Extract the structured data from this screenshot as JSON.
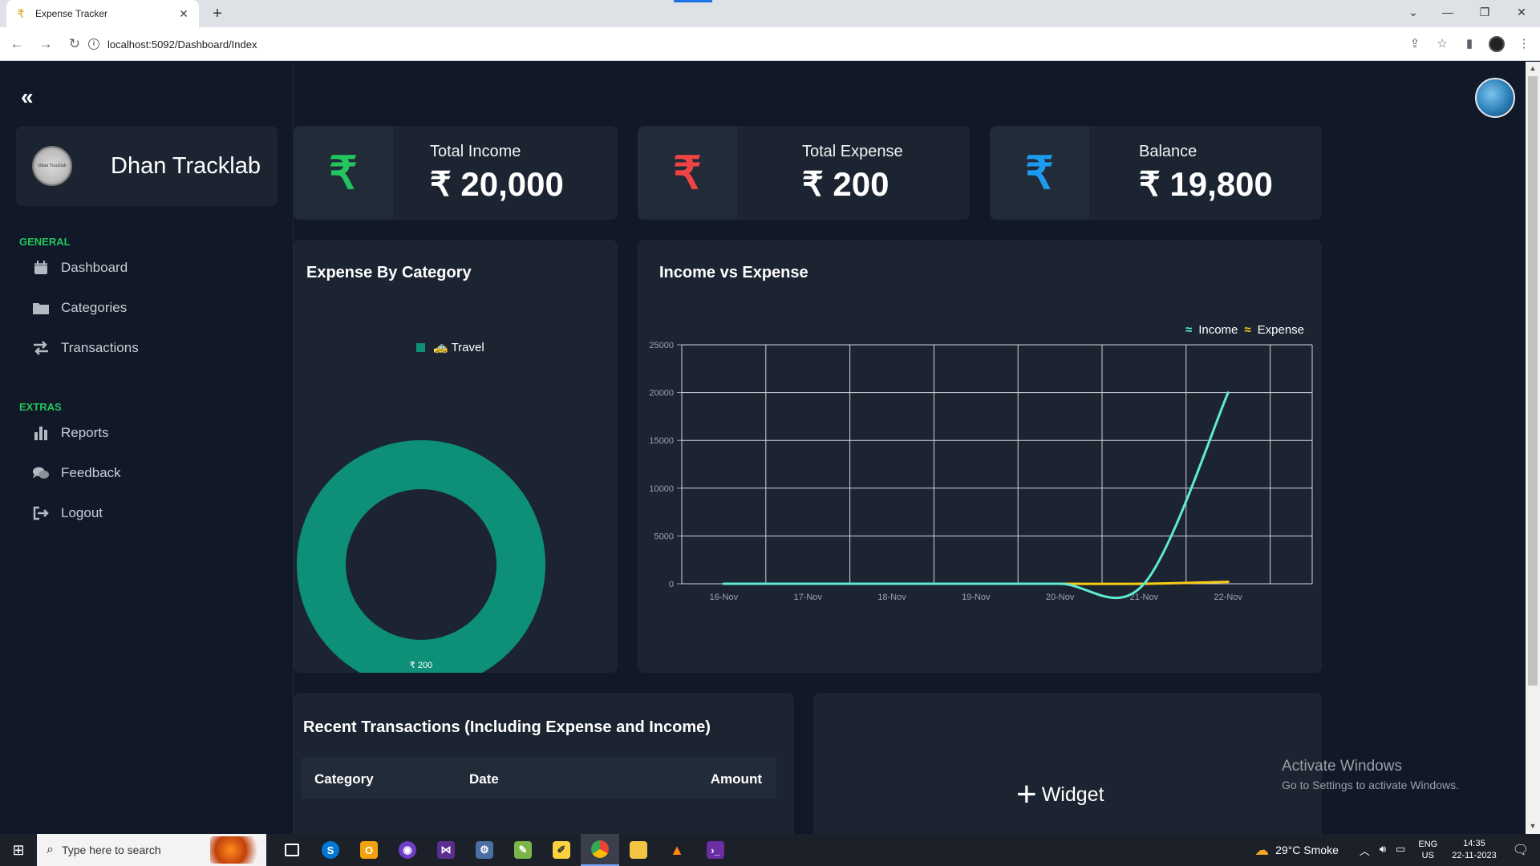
{
  "browser": {
    "tab_title": "Expense Tracker",
    "url": "localhost:5092/Dashboard/Index"
  },
  "sidebar": {
    "brand_name": "Dhan Tracklab",
    "brand_logo_text": "Dhan Tracklab",
    "sections": [
      {
        "label": "GENERAL",
        "items": [
          {
            "label": "Dashboard",
            "icon": "calendar-icon"
          },
          {
            "label": "Categories",
            "icon": "folder-icon"
          },
          {
            "label": "Transactions",
            "icon": "exchange-icon"
          }
        ]
      },
      {
        "label": "EXTRAS",
        "items": [
          {
            "label": "Reports",
            "icon": "bar-chart-icon"
          },
          {
            "label": "Feedback",
            "icon": "comments-icon"
          },
          {
            "label": "Logout",
            "icon": "logout-icon"
          }
        ]
      }
    ]
  },
  "stats": {
    "income": {
      "label": "Total Income",
      "value": "₹ 20,000",
      "icon": "₹",
      "color": "#22c55e"
    },
    "expense": {
      "label": "Total Expense",
      "value": "₹ 200",
      "icon": "₹",
      "color": "#ef4444"
    },
    "balance": {
      "label": "Balance",
      "value": "₹ 19,800",
      "icon": "₹",
      "color": "#1d9bf0"
    }
  },
  "expense_by_category": {
    "title": "Expense By Category",
    "legend": [
      {
        "label": "🚕 Travel",
        "color": "#0e8f78"
      }
    ],
    "center_label": "₹ 200"
  },
  "income_vs_expense": {
    "title": "Income vs Expense",
    "legend": [
      {
        "label": "Income",
        "color": "#5eead4"
      },
      {
        "label": "Expense",
        "color": "#facc15"
      }
    ]
  },
  "recent_transactions": {
    "title": "Recent Transactions (Including Expense and Income)",
    "columns": [
      "Category",
      "Date",
      "Amount"
    ]
  },
  "widget": {
    "label": "Widget"
  },
  "watermark": {
    "line1": "Activate Windows",
    "line2": "Go to Settings to activate Windows."
  },
  "taskbar": {
    "search_placeholder": "Type here to search",
    "weather": "29°C  Smoke",
    "lang_line1": "ENG",
    "lang_line2": "US",
    "time": "14:35",
    "date": "22-11-2023"
  },
  "chart_data": [
    {
      "type": "pie",
      "title": "Expense By Category",
      "labels": [
        "🚕 Travel"
      ],
      "values": [
        200
      ],
      "colors": [
        "#0e8f78"
      ],
      "data_labels": [
        "₹ 200"
      ],
      "legend": "top"
    },
    {
      "type": "line",
      "title": "Income vs Expense",
      "categories": [
        "16-Nov",
        "17-Nov",
        "18-Nov",
        "19-Nov",
        "20-Nov",
        "21-Nov",
        "22-Nov"
      ],
      "series": [
        {
          "name": "Income",
          "values": [
            0,
            0,
            0,
            0,
            0,
            0,
            20000
          ],
          "color": "#5eead4"
        },
        {
          "name": "Expense",
          "values": [
            0,
            0,
            0,
            0,
            0,
            0,
            200
          ],
          "color": "#facc15"
        }
      ],
      "ylim": [
        0,
        25000
      ],
      "yticks": [
        0,
        5000,
        10000,
        15000,
        20000,
        25000
      ],
      "grid": true,
      "legend": "top-right"
    }
  ]
}
